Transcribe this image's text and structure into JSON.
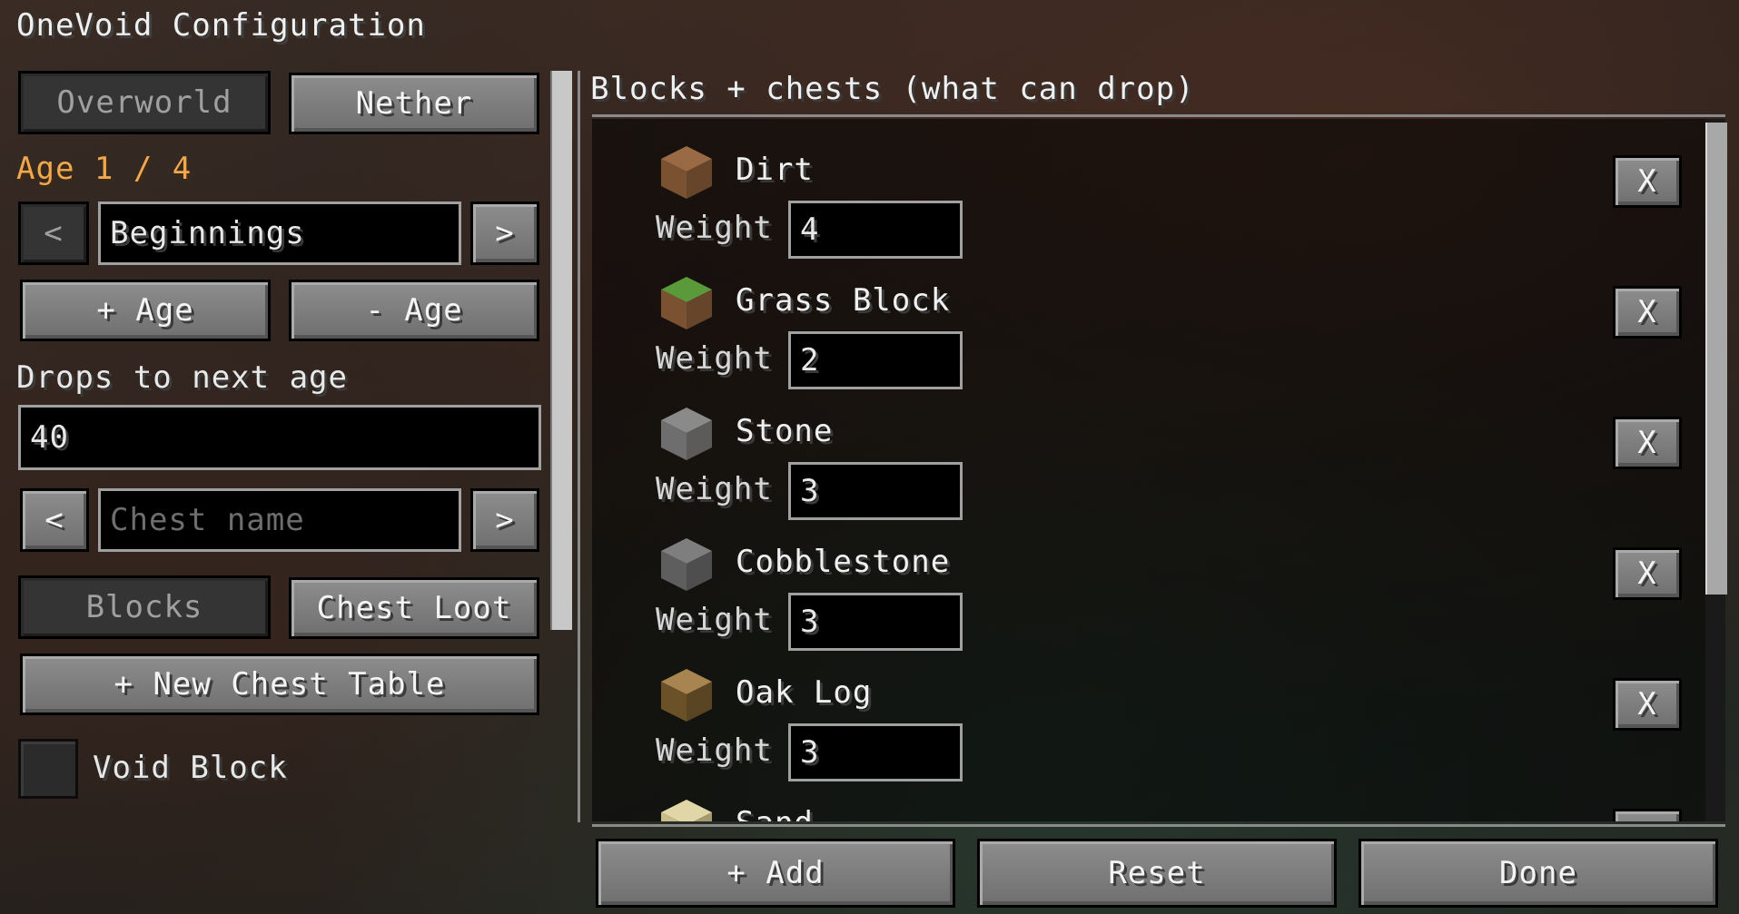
{
  "title": "OneVoid Configuration",
  "dimension_tabs": {
    "overworld": "Overworld",
    "nether": "Nether"
  },
  "age": {
    "label": "Age 1 / 4",
    "prev": "<",
    "next": ">",
    "name": "Beginnings",
    "add": "+ Age",
    "remove": "- Age"
  },
  "drops": {
    "label": "Drops to next age",
    "value": "40"
  },
  "chest": {
    "prev": "<",
    "next": ">",
    "placeholder": "Chest name"
  },
  "mode_tabs": {
    "blocks": "Blocks",
    "chest_loot": "Chest Loot"
  },
  "new_chest_table": "+ New Chest Table",
  "void_block": {
    "label": "Void Block",
    "checked": false
  },
  "list": {
    "header": "Blocks + chests (what can drop)",
    "weight_label": "Weight",
    "remove_label": "X",
    "items": [
      {
        "name": "Dirt",
        "weight": "4",
        "icon": "dirt-block-icon",
        "top": "#9a6a44",
        "side": "#7a5232"
      },
      {
        "name": "Grass Block",
        "weight": "2",
        "icon": "grass-block-icon",
        "top": "#5a9a3a",
        "side": "#7a5232"
      },
      {
        "name": "Stone",
        "weight": "3",
        "icon": "stone-block-icon",
        "top": "#8a8a8a",
        "side": "#6e6e6e"
      },
      {
        "name": "Cobblestone",
        "weight": "3",
        "icon": "cobblestone-block-icon",
        "top": "#7e7e7e",
        "side": "#5e5e5e"
      },
      {
        "name": "Oak Log",
        "weight": "3",
        "icon": "oak-log-icon",
        "top": "#a88450",
        "side": "#6b5128"
      },
      {
        "name": "Sand",
        "weight": "",
        "icon": "sand-block-icon",
        "top": "#e0d6a8",
        "side": "#c8bc88"
      }
    ]
  },
  "footer": {
    "add": "+ Add",
    "reset": "Reset",
    "done": "Done"
  }
}
